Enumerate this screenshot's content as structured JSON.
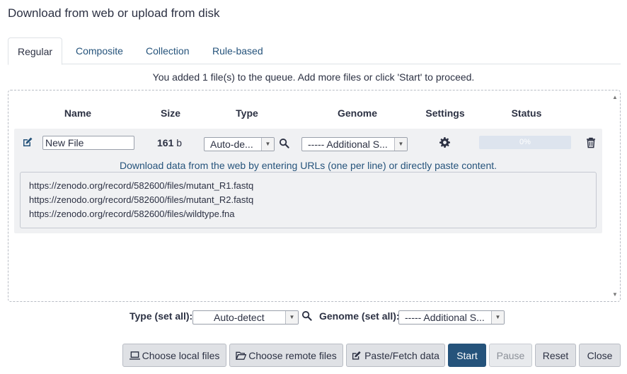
{
  "dialog": {
    "title": "Download from web or upload from disk"
  },
  "tabs": [
    {
      "label": "Regular",
      "active": true
    },
    {
      "label": "Composite"
    },
    {
      "label": "Collection"
    },
    {
      "label": "Rule-based"
    }
  ],
  "queue_info": "You added 1 file(s) to the queue. Add more files or click 'Start' to proceed.",
  "table": {
    "headers": {
      "name": "Name",
      "size": "Size",
      "type": "Type",
      "genome": "Genome",
      "settings": "Settings",
      "status": "Status"
    }
  },
  "row": {
    "name_value": "New File",
    "size_value": "161",
    "size_unit": "b",
    "type_value": "Auto-de...",
    "genome_value": "----- Additional S...",
    "progress_label": "0%",
    "progress": 0,
    "paste_hint": "Download data from the web by entering URLs (one per line) or directly paste content.",
    "urls": [
      "https://zenodo.org/record/582600/files/mutant_R1.fastq",
      "https://zenodo.org/record/582600/files/mutant_R2.fastq",
      "https://zenodo.org/record/582600/files/wildtype.fna"
    ]
  },
  "set_all": {
    "type_label": "Type (set all):",
    "type_value": "Auto-detect",
    "genome_label": "Genome (set all):",
    "genome_value": "----- Additional S..."
  },
  "buttons": {
    "local": "Choose local files",
    "remote": "Choose remote files",
    "paste": "Paste/Fetch data",
    "start": "Start",
    "pause": "Pause",
    "reset": "Reset",
    "close": "Close"
  },
  "colors": {
    "accent": "#25537b",
    "text": "#2c3143",
    "row_bg": "#f0f1f3",
    "button_bg": "#dfe1e5"
  }
}
